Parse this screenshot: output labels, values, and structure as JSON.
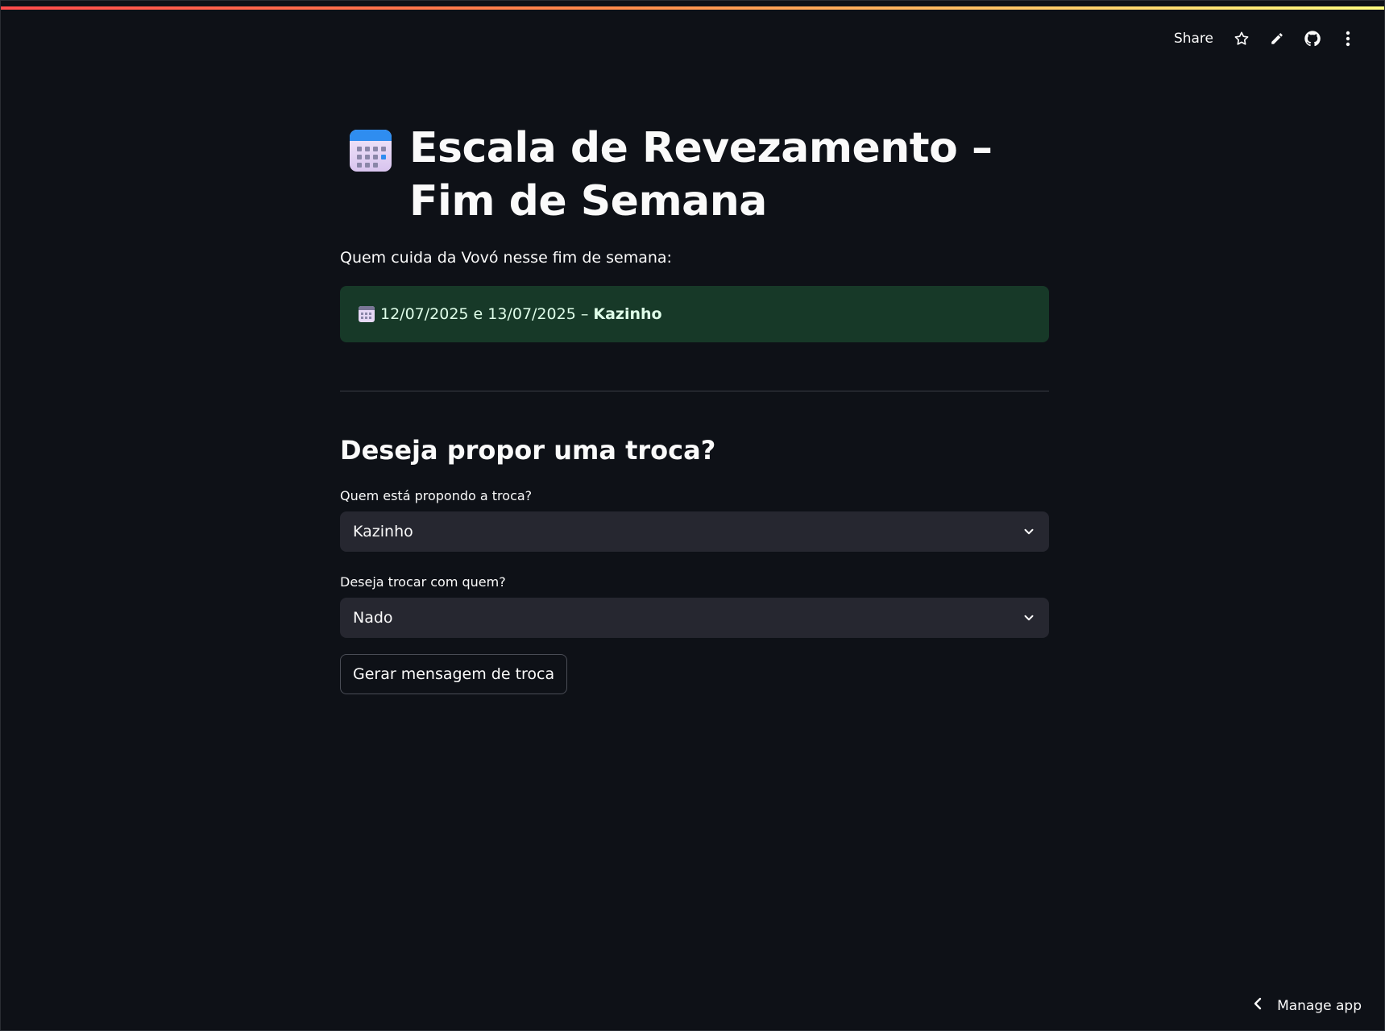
{
  "toolbar": {
    "share_label": "Share",
    "icons": [
      "star-icon",
      "pencil-icon",
      "github-icon",
      "more-vertical-icon"
    ]
  },
  "header": {
    "title": "Escala de Revezamento – Fim de Semana",
    "title_icon": "calendar-icon"
  },
  "main": {
    "caption": "Quem cuida da Vovó nesse fim de semana:",
    "alert": {
      "icon": "calendar-icon",
      "dates": "12/07/2025 e 13/07/2025 –",
      "name": "Kazinho",
      "bg_color": "#173928"
    },
    "subheader": "Deseja propor uma troca?",
    "proposer": {
      "label": "Quem está propondo a troca?",
      "value": "Kazinho"
    },
    "target": {
      "label": "Deseja trocar com quem?",
      "value": "Nado"
    },
    "generate_button": "Gerar mensagem de troca"
  },
  "footer": {
    "manage_label": "Manage app"
  },
  "colors": {
    "background": "#0e1117",
    "input_bg": "#262730",
    "accent_gradient": [
      "#ff4b4b",
      "#fffd80"
    ]
  }
}
